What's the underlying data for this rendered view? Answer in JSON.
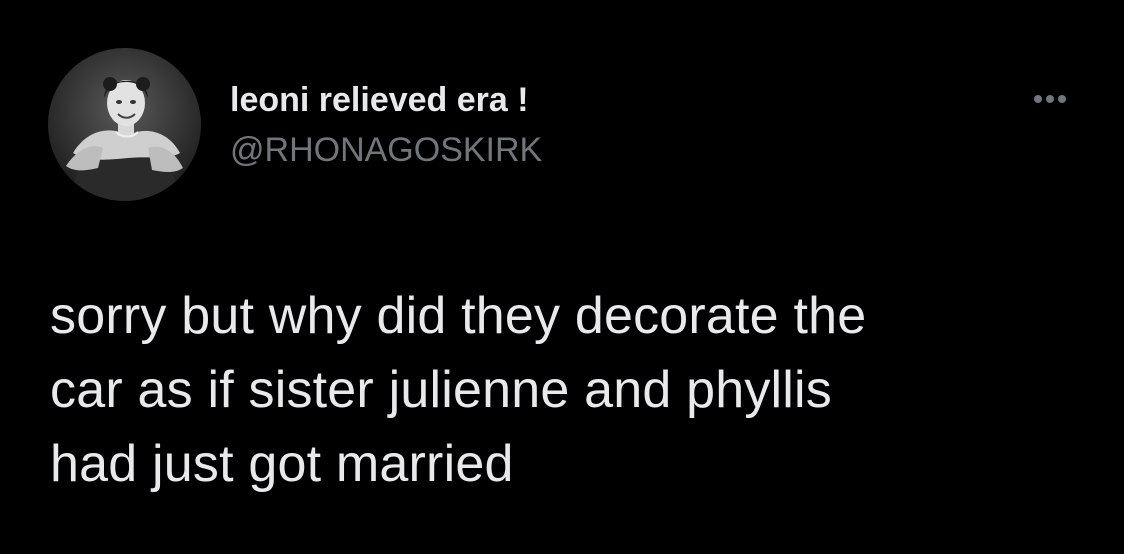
{
  "author": {
    "display_name": "leoni relieved era !",
    "handle": "@RHONAGOSKIRK",
    "avatar_icon": "profile-photo-icon"
  },
  "menu": {
    "icon": "more-dots-icon"
  },
  "tweet": {
    "lines": [
      "sorry but why did they decorate the",
      "car as if sister julienne and phyllis",
      "had just got married"
    ]
  },
  "colors": {
    "background": "#000000",
    "primary_text": "#e7e9ea",
    "secondary_text": "#71767b"
  }
}
